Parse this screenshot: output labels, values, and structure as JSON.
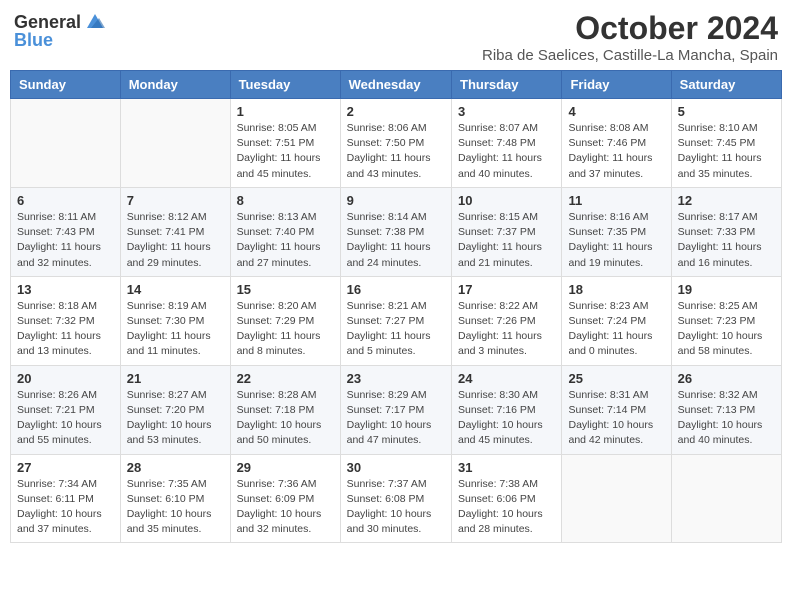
{
  "header": {
    "logo_general": "General",
    "logo_blue": "Blue",
    "month_title": "October 2024",
    "location": "Riba de Saelices, Castille-La Mancha, Spain"
  },
  "days_of_week": [
    "Sunday",
    "Monday",
    "Tuesday",
    "Wednesday",
    "Thursday",
    "Friday",
    "Saturday"
  ],
  "weeks": [
    [
      {
        "day": "",
        "info": ""
      },
      {
        "day": "",
        "info": ""
      },
      {
        "day": "1",
        "info": "Sunrise: 8:05 AM\nSunset: 7:51 PM\nDaylight: 11 hours and 45 minutes."
      },
      {
        "day": "2",
        "info": "Sunrise: 8:06 AM\nSunset: 7:50 PM\nDaylight: 11 hours and 43 minutes."
      },
      {
        "day": "3",
        "info": "Sunrise: 8:07 AM\nSunset: 7:48 PM\nDaylight: 11 hours and 40 minutes."
      },
      {
        "day": "4",
        "info": "Sunrise: 8:08 AM\nSunset: 7:46 PM\nDaylight: 11 hours and 37 minutes."
      },
      {
        "day": "5",
        "info": "Sunrise: 8:10 AM\nSunset: 7:45 PM\nDaylight: 11 hours and 35 minutes."
      }
    ],
    [
      {
        "day": "6",
        "info": "Sunrise: 8:11 AM\nSunset: 7:43 PM\nDaylight: 11 hours and 32 minutes."
      },
      {
        "day": "7",
        "info": "Sunrise: 8:12 AM\nSunset: 7:41 PM\nDaylight: 11 hours and 29 minutes."
      },
      {
        "day": "8",
        "info": "Sunrise: 8:13 AM\nSunset: 7:40 PM\nDaylight: 11 hours and 27 minutes."
      },
      {
        "day": "9",
        "info": "Sunrise: 8:14 AM\nSunset: 7:38 PM\nDaylight: 11 hours and 24 minutes."
      },
      {
        "day": "10",
        "info": "Sunrise: 8:15 AM\nSunset: 7:37 PM\nDaylight: 11 hours and 21 minutes."
      },
      {
        "day": "11",
        "info": "Sunrise: 8:16 AM\nSunset: 7:35 PM\nDaylight: 11 hours and 19 minutes."
      },
      {
        "day": "12",
        "info": "Sunrise: 8:17 AM\nSunset: 7:33 PM\nDaylight: 11 hours and 16 minutes."
      }
    ],
    [
      {
        "day": "13",
        "info": "Sunrise: 8:18 AM\nSunset: 7:32 PM\nDaylight: 11 hours and 13 minutes."
      },
      {
        "day": "14",
        "info": "Sunrise: 8:19 AM\nSunset: 7:30 PM\nDaylight: 11 hours and 11 minutes."
      },
      {
        "day": "15",
        "info": "Sunrise: 8:20 AM\nSunset: 7:29 PM\nDaylight: 11 hours and 8 minutes."
      },
      {
        "day": "16",
        "info": "Sunrise: 8:21 AM\nSunset: 7:27 PM\nDaylight: 11 hours and 5 minutes."
      },
      {
        "day": "17",
        "info": "Sunrise: 8:22 AM\nSunset: 7:26 PM\nDaylight: 11 hours and 3 minutes."
      },
      {
        "day": "18",
        "info": "Sunrise: 8:23 AM\nSunset: 7:24 PM\nDaylight: 11 hours and 0 minutes."
      },
      {
        "day": "19",
        "info": "Sunrise: 8:25 AM\nSunset: 7:23 PM\nDaylight: 10 hours and 58 minutes."
      }
    ],
    [
      {
        "day": "20",
        "info": "Sunrise: 8:26 AM\nSunset: 7:21 PM\nDaylight: 10 hours and 55 minutes."
      },
      {
        "day": "21",
        "info": "Sunrise: 8:27 AM\nSunset: 7:20 PM\nDaylight: 10 hours and 53 minutes."
      },
      {
        "day": "22",
        "info": "Sunrise: 8:28 AM\nSunset: 7:18 PM\nDaylight: 10 hours and 50 minutes."
      },
      {
        "day": "23",
        "info": "Sunrise: 8:29 AM\nSunset: 7:17 PM\nDaylight: 10 hours and 47 minutes."
      },
      {
        "day": "24",
        "info": "Sunrise: 8:30 AM\nSunset: 7:16 PM\nDaylight: 10 hours and 45 minutes."
      },
      {
        "day": "25",
        "info": "Sunrise: 8:31 AM\nSunset: 7:14 PM\nDaylight: 10 hours and 42 minutes."
      },
      {
        "day": "26",
        "info": "Sunrise: 8:32 AM\nSunset: 7:13 PM\nDaylight: 10 hours and 40 minutes."
      }
    ],
    [
      {
        "day": "27",
        "info": "Sunrise: 7:34 AM\nSunset: 6:11 PM\nDaylight: 10 hours and 37 minutes."
      },
      {
        "day": "28",
        "info": "Sunrise: 7:35 AM\nSunset: 6:10 PM\nDaylight: 10 hours and 35 minutes."
      },
      {
        "day": "29",
        "info": "Sunrise: 7:36 AM\nSunset: 6:09 PM\nDaylight: 10 hours and 32 minutes."
      },
      {
        "day": "30",
        "info": "Sunrise: 7:37 AM\nSunset: 6:08 PM\nDaylight: 10 hours and 30 minutes."
      },
      {
        "day": "31",
        "info": "Sunrise: 7:38 AM\nSunset: 6:06 PM\nDaylight: 10 hours and 28 minutes."
      },
      {
        "day": "",
        "info": ""
      },
      {
        "day": "",
        "info": ""
      }
    ]
  ]
}
